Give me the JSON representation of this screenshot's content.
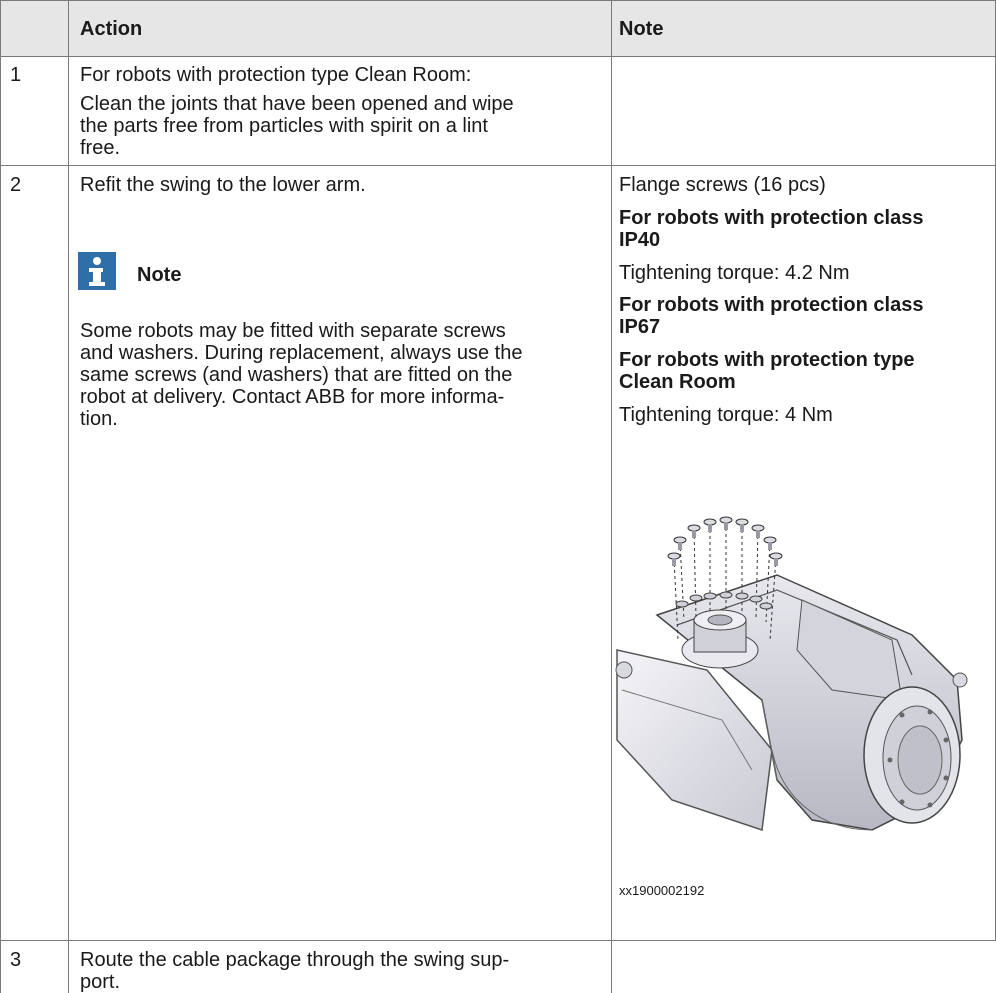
{
  "table": {
    "headers": {
      "action": "Action",
      "note": "Note"
    },
    "rows": [
      {
        "step": "1",
        "action_lines": [
          "For robots with protection type Clean Room:",
          "Clean the joints that have been opened and wipe",
          "the parts free from particles with spirit on a lint",
          "free."
        ]
      },
      {
        "step": "2",
        "action_first": "Refit the swing to the lower arm.",
        "note_box_title": "Note",
        "note_box_icon": "info-icon",
        "action_body_lines": [
          "Some robots may be fitted with separate screws",
          "and washers. During replacement, always use the",
          "same screws (and washers) that are fitted on the",
          "robot at delivery. Contact ABB for more informa-",
          "tion."
        ],
        "note_lines": [
          {
            "text": "Flange screws (16 pcs)",
            "bold": false
          },
          {
            "text": "For robots with protection class",
            "bold": true
          },
          {
            "text": "IP40",
            "bold": true
          },
          {
            "text": "Tightening torque: 4.2 Nm",
            "bold": false
          },
          {
            "text": "For robots with protection class",
            "bold": true
          },
          {
            "text": "IP67",
            "bold": true
          },
          {
            "text": "For robots with protection type",
            "bold": true
          },
          {
            "text": "Clean Room",
            "bold": true
          },
          {
            "text": "Tightening torque: 4 Nm",
            "bold": false
          }
        ],
        "figure_caption": "xx1900002192"
      },
      {
        "step": "3",
        "action_lines": [
          "Route the cable package through the swing sup-",
          "port."
        ]
      }
    ]
  }
}
